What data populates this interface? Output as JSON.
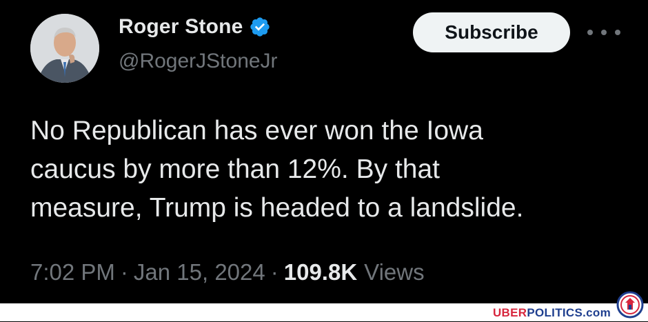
{
  "tweet": {
    "display_name": "Roger Stone",
    "handle": "@RogerJStoneJr",
    "subscribe_label": "Subscribe",
    "text": "No Republican has ever won the Iowa\ncaucus by more than 12%. By that\nmeasure, Trump is headed to a landslide.",
    "time": "7:02 PM",
    "separator": "·",
    "date": "Jan 15, 2024",
    "views_count": "109.8K",
    "views_label": "Views"
  },
  "footer": {
    "brand_part1": "UBER",
    "brand_part2": "POLITICS.com"
  },
  "icons": {
    "verified": "verified-badge-icon",
    "more": "more-options-icon",
    "logo": "uberpolitics-logo"
  },
  "colors": {
    "background": "#000000",
    "text": "#e7e9ea",
    "secondary": "#71767b",
    "verified": "#1d9bf0",
    "subscribe_bg": "#eff3f4",
    "brand_red": "#d7263d",
    "brand_blue": "#1f3f8f"
  }
}
